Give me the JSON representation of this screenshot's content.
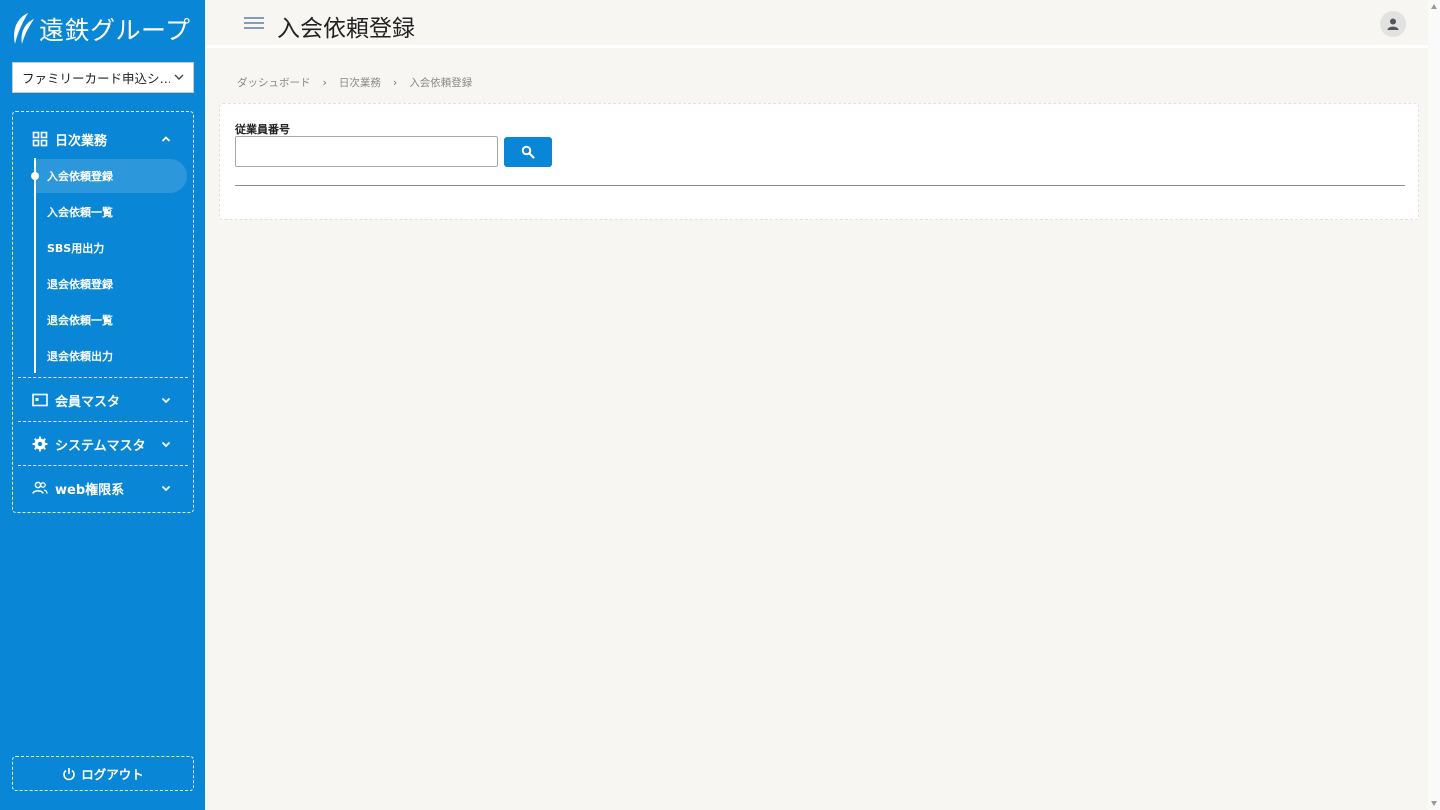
{
  "brand": {
    "logo_text": "遠鉄グループ",
    "primary_color": "#0a86d6"
  },
  "system_select": {
    "value": "ファミリーカード申込シ…",
    "chevron": "chevron-down-icon"
  },
  "nav": {
    "groups": [
      {
        "label": "日次業務",
        "icon": "dashboard-grid-icon",
        "expanded": true,
        "items": [
          {
            "label": "入会依頼登録",
            "active": true
          },
          {
            "label": "入会依頼一覧"
          },
          {
            "label": "SBS用出力"
          },
          {
            "label": "退会依頼登録"
          },
          {
            "label": "退会依頼一覧"
          },
          {
            "label": "退会依頼出力"
          }
        ]
      },
      {
        "label": "会員マスタ",
        "icon": "id-card-icon",
        "expanded": false
      },
      {
        "label": "システムマスタ",
        "icon": "gear-icon",
        "expanded": false
      },
      {
        "label": "web権限系",
        "icon": "users-icon",
        "expanded": false
      }
    ],
    "logout_label": "ログアウト"
  },
  "header": {
    "title": "入会依頼登録"
  },
  "breadcrumb": [
    "ダッシュボード",
    "日次業務",
    "入会依頼登録"
  ],
  "form": {
    "employee_number_label": "従業員番号",
    "employee_number_value": "",
    "search_icon": "search-icon"
  }
}
